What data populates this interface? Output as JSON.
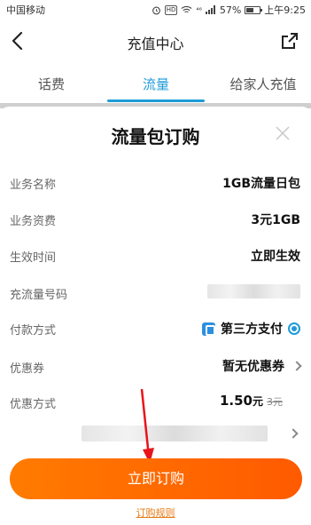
{
  "status_bar": {
    "carrier": "中国移动",
    "battery": "57%",
    "battery_level": 0.57,
    "time": "上午9:25",
    "hd": "HD",
    "signal": "⁴⁶"
  },
  "nav": {
    "title": "充值中心"
  },
  "tabs": [
    {
      "label": "话费"
    },
    {
      "label": "流量"
    },
    {
      "label": "给家人充值"
    }
  ],
  "sheet": {
    "title": "流量包订购",
    "rows": {
      "business_name": {
        "label": "业务名称",
        "value": "1GB流量日包"
      },
      "business_fee": {
        "label": "业务资费",
        "value": "3元1GB"
      },
      "effective_time": {
        "label": "生效时间",
        "value": "立即生效"
      },
      "recharge_number": {
        "label": "充流量号码"
      },
      "payment_method": {
        "label": "付款方式",
        "value": "第三方支付"
      },
      "coupon": {
        "label": "优惠券",
        "value": "暂无优惠券"
      },
      "discount": {
        "label": "优惠方式",
        "price": "1.50",
        "unit": "元",
        "original": "3元"
      }
    },
    "order_button": "立即订购",
    "rules_link": "订购规则"
  },
  "colors": {
    "accent": "#1e9bd7",
    "order_button": "#ff6a00",
    "rules_link": "#e87a14"
  }
}
